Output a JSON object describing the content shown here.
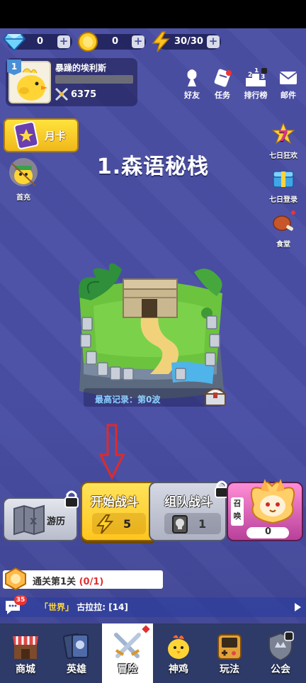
{
  "resources": {
    "gems": "0",
    "coins": "0",
    "energy": "30/30"
  },
  "player": {
    "level": "1",
    "name": "暴躁的埃利斯",
    "power": "6375"
  },
  "top_menu": [
    {
      "label": "好友",
      "icon": "friend-icon"
    },
    {
      "label": "任务",
      "icon": "quest-scroll-icon"
    },
    {
      "label": "排行榜",
      "icon": "leaderboard-icon"
    },
    {
      "label": "邮件",
      "icon": "mail-icon"
    }
  ],
  "monthly_card": {
    "label": "月卡"
  },
  "first_recharge": {
    "label": "首充"
  },
  "stage": {
    "title": "1.森语秘栈",
    "record": "最高记录：第0波"
  },
  "side_events": [
    {
      "label": "七日狂欢",
      "icon": "seven-day-carnival-icon"
    },
    {
      "label": "七日登录",
      "icon": "seven-day-login-icon"
    },
    {
      "label": "食堂",
      "icon": "canteen-meat-icon"
    }
  ],
  "modes": {
    "adventure": {
      "label": "游历"
    },
    "start": {
      "label": "开始战斗",
      "cost": "5"
    },
    "team": {
      "label": "组队战斗",
      "cost": "1"
    },
    "summon": {
      "label": "召唤",
      "count": "0"
    }
  },
  "task": {
    "label": "通关第1关",
    "progress": "(0/1)"
  },
  "chat": {
    "badge": "35",
    "channel": "「世界」",
    "user": "古拉拉:",
    "message": "[14]"
  },
  "nav": [
    {
      "label": "商城",
      "icon": "shop-icon"
    },
    {
      "label": "英雄",
      "icon": "hero-cards-icon"
    },
    {
      "label": "冒险",
      "icon": "crossed-swords-icon"
    },
    {
      "label": "神鸡",
      "icon": "chicken-icon"
    },
    {
      "label": "玩法",
      "icon": "game-console-icon"
    },
    {
      "label": "公会",
      "icon": "guild-shield-icon"
    }
  ],
  "colors": {
    "background": "#4a4fa6",
    "start_button": "#ffd22e",
    "nav_bar": "#2e3a67",
    "accent_red": "#e03030"
  }
}
